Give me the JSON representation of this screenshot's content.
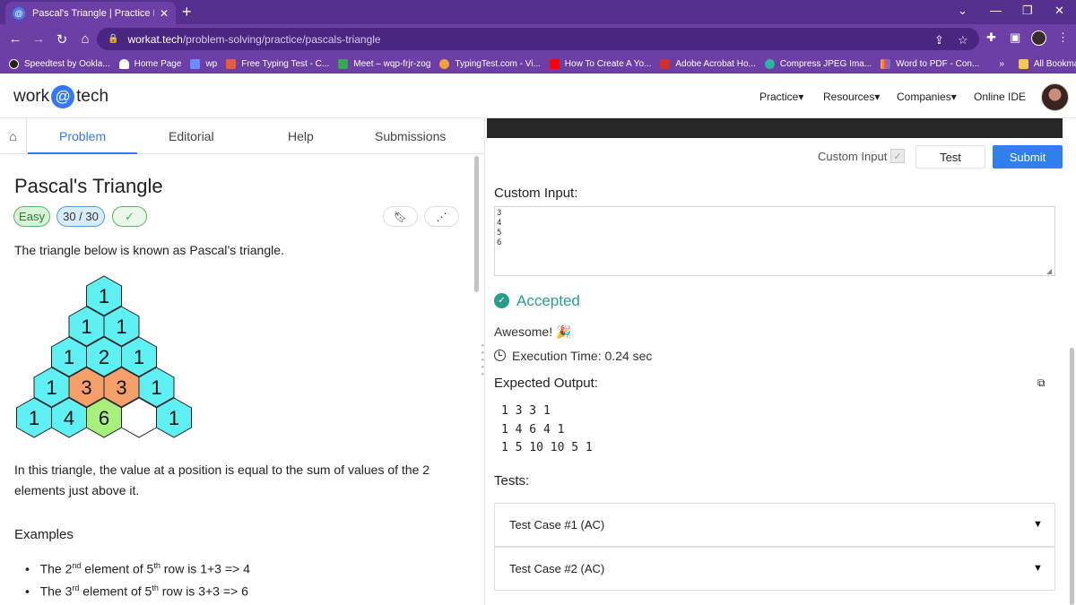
{
  "browser": {
    "tab_title": "Pascal's Triangle | Practice Probl",
    "url_domain": "workat.tech",
    "url_path": "/problem-solving/practice/pascals-triangle",
    "bookmarks": [
      {
        "label": "Speedtest by Ookla...",
        "color": "#222222"
      },
      {
        "label": "Home Page",
        "color": "#ffffff"
      },
      {
        "label": "wp",
        "color": "#6a8cff"
      },
      {
        "label": "Free Typing Test - C...",
        "color": "#e45c3a"
      },
      {
        "label": "Meet – wqp-frjr-zog",
        "color": "#34a853"
      },
      {
        "label": "TypingTest.com - Vi...",
        "color": "#f4a13a"
      },
      {
        "label": "How To Create A Yo...",
        "color": "#ff0000"
      },
      {
        "label": "Adobe Acrobat Ho...",
        "color": "#d32f2f"
      },
      {
        "label": "Compress JPEG Ima...",
        "color": "#2bb3a3"
      },
      {
        "label": "Word to PDF - Con...",
        "color": "#e8c12f"
      }
    ],
    "more_bookmarks": "»",
    "all_bookmarks": "All Bookmarks"
  },
  "site": {
    "logo_left": "work",
    "logo_at": "@",
    "logo_right": "tech",
    "menu": [
      "Practice▾",
      "Resources▾",
      "Companies▾",
      "Online IDE"
    ]
  },
  "problem": {
    "tabs": [
      "Problem",
      "Editorial",
      "Help",
      "Submissions"
    ],
    "title": "Pascal's Triangle",
    "difficulty": "Easy",
    "score": "30 / 30",
    "intro": "The triangle below is known as Pascal’s triangle.",
    "triangle_rows": [
      [
        "1"
      ],
      [
        "1",
        "1"
      ],
      [
        "1",
        "2",
        "1"
      ],
      [
        "1",
        "3",
        "3",
        "1"
      ],
      [
        "1",
        "4",
        "6",
        "",
        "1"
      ]
    ],
    "description_line1": "In this triangle, the value at a position is equal to the sum of values of the 2",
    "description_line2": "elements just above it.",
    "examples_heading": "Examples",
    "example1": {
      "a": "The 2",
      "sup1": "nd",
      "b": " element of 5",
      "sup2": "th",
      "c": " row is 1+3 => 4"
    },
    "example2": {
      "a": "The 3",
      "sup1": "rd",
      "b": " element of 5",
      "sup2": "th",
      "c": " row is 3+3 => 6"
    }
  },
  "console": {
    "custom_input_label": "Custom Input",
    "test_button": "Test",
    "submit_button": "Submit",
    "custom_input_heading": "Custom Input:",
    "custom_input_value": "3\n4\n5\n6",
    "status": "Accepted",
    "message": "Awesome! 🎉",
    "execution_time": "Execution Time: 0.24 sec",
    "expected_output_heading": "Expected Output:",
    "expected_output": "1 3 3 1\n1 4 6 4 1\n1 5 10 10 5 1",
    "tests_heading": "Tests:",
    "tests": [
      "Test Case #1 (AC)",
      "Test Case #2 (AC)"
    ]
  }
}
